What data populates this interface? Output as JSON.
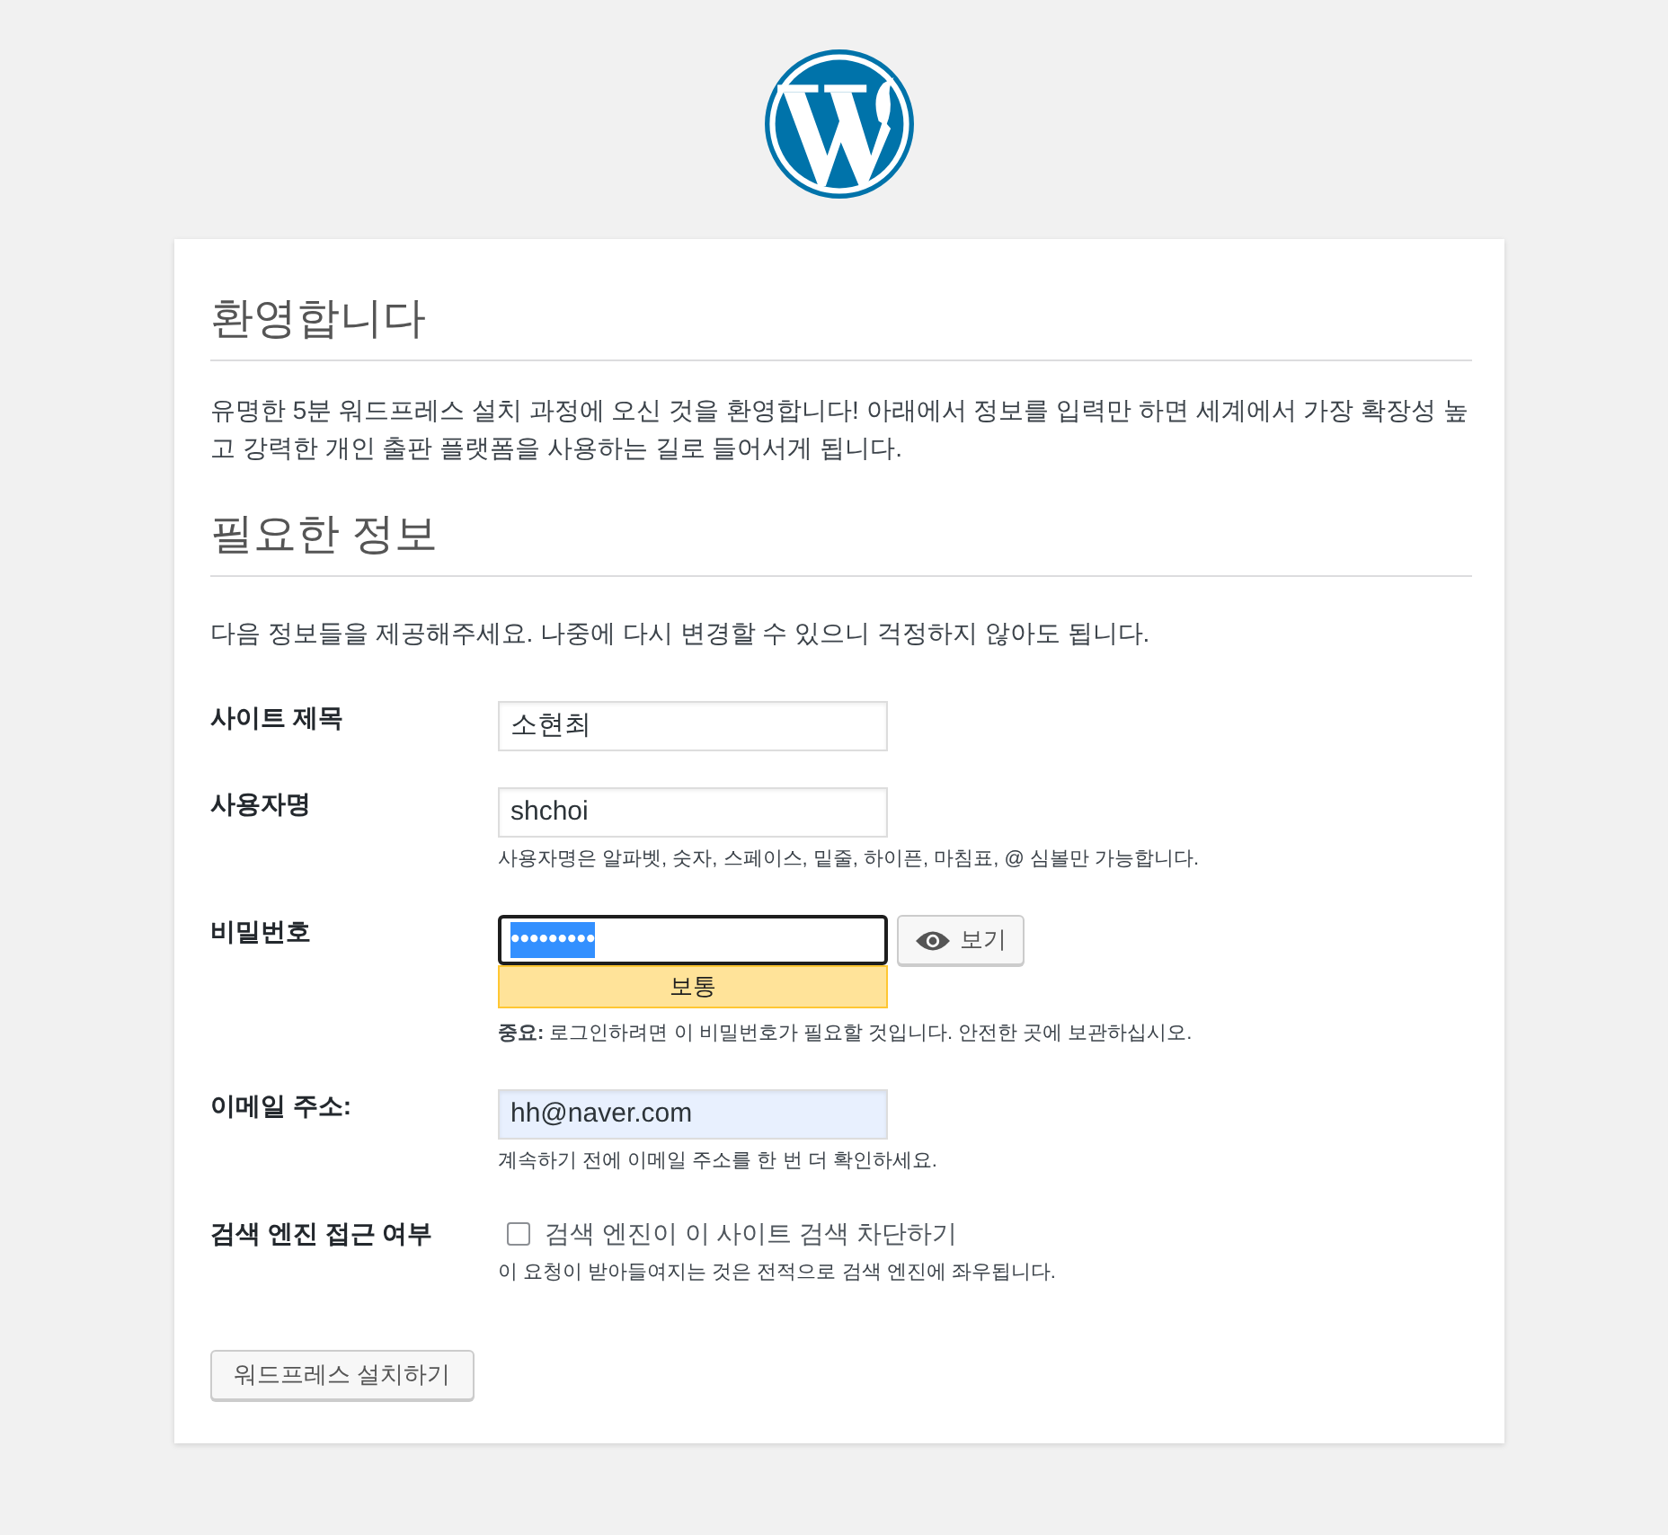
{
  "welcome": {
    "heading": "환영합니다",
    "text": "유명한 5분 워드프레스 설치 과정에 오신 것을 환영합니다! 아래에서 정보를 입력만 하면 세계에서 가장 확장성 높고 강력한 개인 출판 플랫폼을 사용하는 길로 들어서게 됩니다."
  },
  "required_info": {
    "heading": "필요한 정보",
    "text": "다음 정보들을 제공해주세요. 나중에 다시 변경할 수 있으니 걱정하지 않아도 됩니다."
  },
  "form": {
    "fields": [
      {
        "kind": "text",
        "label": "사이트 제목",
        "value": "소현최",
        "focused": false,
        "autofilled": false,
        "text_selected": false
      },
      {
        "kind": "text",
        "label": "사용자명",
        "value": "shchoi",
        "focused": false,
        "autofilled": false,
        "text_selected": false,
        "description": "사용자명은 알파벳, 숫자, 스페이스, 밑줄, 하이픈, 마침표, @ 심볼만 가능합니다."
      },
      {
        "kind": "password",
        "label": "비밀번호",
        "value": "•••••••••",
        "focused": true,
        "autofilled": false,
        "text_selected": true,
        "show_button": "보기",
        "strength": {
          "label": "보통",
          "kind": "medium"
        },
        "description": "**중요:** 로그인하려면 이 비밀번호가 필요할 것입니다. 안전한 곳에 보관하십시오."
      },
      {
        "kind": "text",
        "label": "이메일 주소:",
        "value": "hh@naver.com",
        "focused": false,
        "autofilled": true,
        "text_selected": false,
        "description": "계속하기 전에 이메일 주소를 한 번 더 확인하세요."
      },
      {
        "kind": "checkbox",
        "label": "검색 엔진 접근 여부",
        "checkbox_label": "검색 엔진이 이 사이트 검색 차단하기",
        "checked": false,
        "description": "이 요청이 받아들여지는 것은 전적으로 검색 엔진에 좌우됩니다."
      }
    ]
  },
  "submit_button": "워드프레스 설치하기"
}
